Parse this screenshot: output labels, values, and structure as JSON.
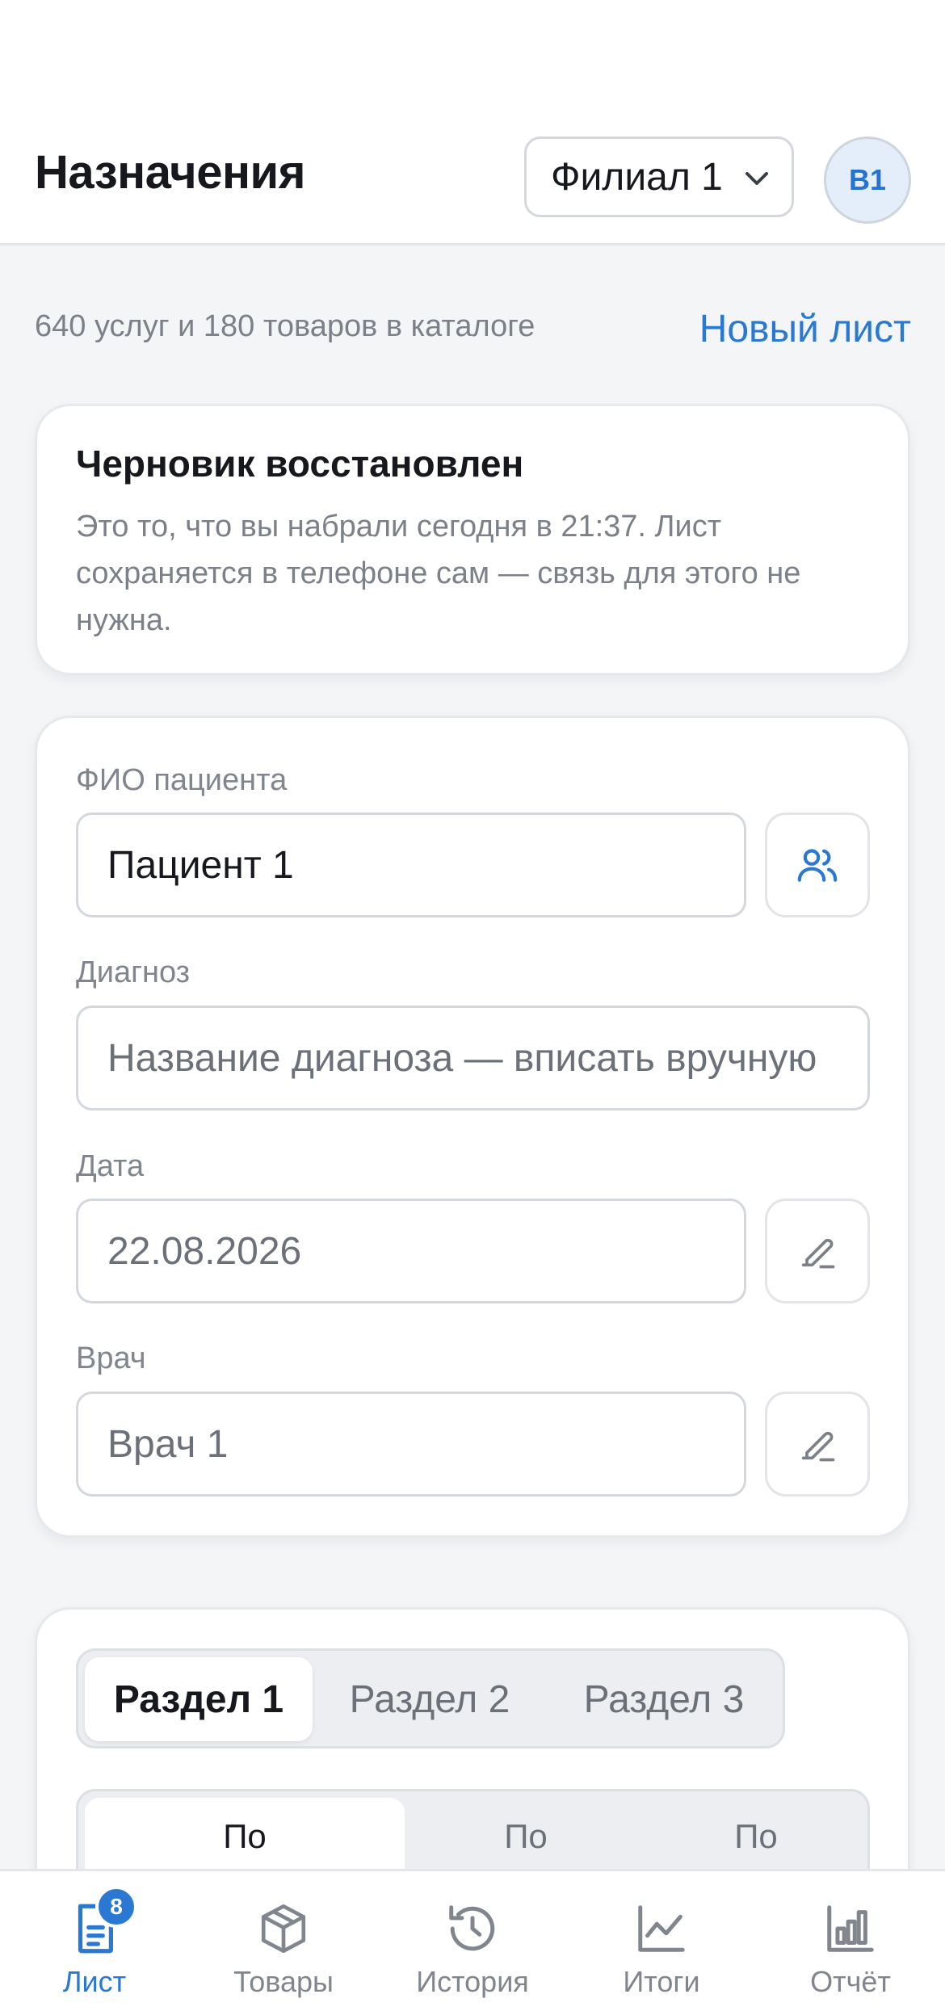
{
  "header": {
    "title": "Назначения",
    "branch": "Филиал 1",
    "avatar": "В1"
  },
  "summary": {
    "catalog_info": "640 услуг и 180 товаров в каталоге",
    "new_sheet_link": "Новый лист"
  },
  "draft": {
    "title": "Черновик восстановлен",
    "message": "Это то, что вы набрали сегодня в 21:37. Лист сохраняется в телефоне сам — связь для этого не нужна."
  },
  "form": {
    "patient_label": "ФИО пациента",
    "patient_value": "Пациент 1",
    "diagnosis_label": "Диагноз",
    "diagnosis_placeholder": "Название диагноза — вписать вручную",
    "date_label": "Дата",
    "date_value": "22.08.2026",
    "doctor_label": "Врач",
    "doctor_value": "Врач 1"
  },
  "sections": {
    "tabs": [
      "Раздел 1",
      "Раздел 2",
      "Раздел 3"
    ],
    "active": 0,
    "subtabs": [
      "По",
      "По",
      "По"
    ]
  },
  "nav": {
    "items": [
      {
        "label": "Лист",
        "icon": "document-icon",
        "badge": "8"
      },
      {
        "label": "Товары",
        "icon": "box-icon"
      },
      {
        "label": "История",
        "icon": "history-icon"
      },
      {
        "label": "Итоги",
        "icon": "chart-line-icon"
      },
      {
        "label": "Отчёт",
        "icon": "bar-chart-icon"
      }
    ]
  },
  "colors": {
    "accent": "#2a78d2",
    "background": "#f4f5f7"
  }
}
